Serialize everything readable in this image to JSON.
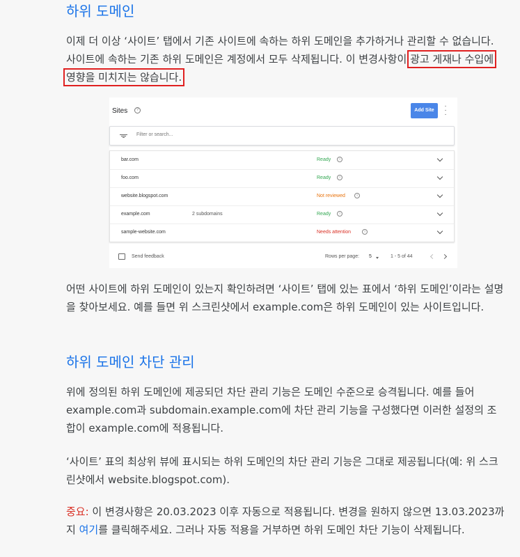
{
  "section1": {
    "heading": "하위 도메인",
    "p1_before": "이제 더 이상 ‘사이트’ 탭에서 기존 사이트에 속하는 하위 도메인을 추가하거나 관리할 수 없습니다. 사이트에 속하는 기존 하위 도메인은 계정에서 모두 삭제됩니다. 이 변경사항이 ",
    "p1_highlight": "광고 게재나 수입에 영향을 미치지는 않습니다.",
    "p2": "어떤 사이트에 하위 도메인이 있는지 확인하려면 ‘사이트’ 탭에 있는 표에서 ‘하위 도메인’이라는 설명을 찾아보세요. 예를 들면 위 스크린샷에서 example.com은 하위 도메인이 있는 사이트입니다."
  },
  "screenshot": {
    "title": "Sites",
    "add_button": "Add Site",
    "filter_placeholder": "Filter or search...",
    "rows": [
      {
        "domain": "bar.com",
        "sub": "",
        "status": "Ready",
        "color": "#34a853"
      },
      {
        "domain": "foo.com",
        "sub": "",
        "status": "Ready",
        "color": "#34a853"
      },
      {
        "domain": "website.blogspot.com",
        "sub": "",
        "status": "Not reviewed",
        "color": "#e8710a"
      },
      {
        "domain": "example.com",
        "sub": "2 subdomains",
        "status": "Ready",
        "color": "#34a853"
      },
      {
        "domain": "sample-website.com",
        "sub": "",
        "status": "Needs attention",
        "color": "#d93025"
      }
    ],
    "send_feedback": "Send feedback",
    "rows_per_page_label": "Rows per page:",
    "rows_per_page_value": "5",
    "range": "1 - 5 of 44"
  },
  "section2": {
    "heading": "하위 도메인 차단 관리",
    "p1": "위에 정의된 하위 도메인에 제공되던 차단 관리 기능은 도메인 수준으로 승격됩니다. 예를 들어 example.com과 subdomain.example.com에 차단 관리 기능을 구성했다면 이러한 설정의 조합이 example.com에 적용됩니다.",
    "p2": "‘사이트’ 표의 최상위 뷰에 표시되는 하위 도메인의 차단 관리 기능은 그대로 제공됩니다(예: 위 스크린샷에서 website.blogspot.com).",
    "p3_label": "중요:",
    "p3_a": " 이 변경사항은 20.03.2023 이후 자동으로 적용됩니다. 변경을 원하지 않으면 13.03.2023까지 ",
    "p3_link": "여기",
    "p3_b": "를 클릭해주세요. 그러나 자동 적용을 거부하면 하위 도메인 차단 기능이 삭제됩니다."
  }
}
